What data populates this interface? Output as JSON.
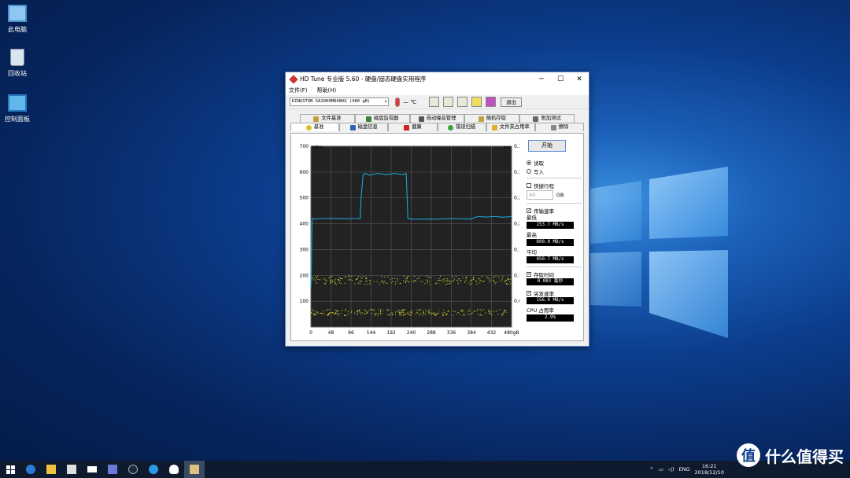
{
  "desktop": {
    "icons": [
      {
        "label": "此电脑",
        "icon": "computer-icon"
      },
      {
        "label": "回收站",
        "icon": "recycle-bin-icon"
      },
      {
        "label": "控制面板",
        "icon": "control-panel-icon"
      }
    ]
  },
  "window": {
    "title": "HD Tune 专业版 5.60 - 硬盘/固态硬盘实用程序",
    "menu": [
      "文件(F)",
      "帮助(H)"
    ],
    "drive": "KINGSTON SA1000M8480G (480 gB)",
    "temperature": "— ℃",
    "exit_label": "退出",
    "tabs_top": [
      "文件基准",
      "磁盘监视器",
      "自动噪音管理",
      "随机存取",
      "附加测试"
    ],
    "tabs_bottom": [
      "基准",
      "磁盘信息",
      "健康",
      "错误扫描",
      "文件夹占用率",
      "擦除"
    ],
    "active_tab": "基准"
  },
  "side": {
    "start_label": "开始",
    "read_label": "读取",
    "write_label": "写入",
    "quick_label": "快捷行程",
    "quick_value": "40",
    "quick_unit": "GB",
    "transfer_label": "传输速率",
    "min_label": "最低",
    "min_value": "153.7 MB/s",
    "max_label": "最高",
    "max_value": "600.0 MB/s",
    "avg_label": "平均",
    "avg_value": "450.7 MB/s",
    "access_label": "存取时间",
    "access_value": "0.083 毫秒",
    "burst_label": "突发速率",
    "burst_value": "156.9 MB/s",
    "cpu_label": "CPU 占用率",
    "cpu_value": "2.9%"
  },
  "chart_data": {
    "type": "line",
    "y_unit_left": "MB/s",
    "y_unit_right": "ms",
    "ylim": [
      0,
      700
    ],
    "ylim_right": [
      0,
      0.35
    ],
    "x_ticks": [
      "0",
      "48",
      "96",
      "144",
      "192",
      "240",
      "288",
      "336",
      "384",
      "432",
      "480gB"
    ],
    "y_ticks_left": [
      "100",
      "200",
      "300",
      "400",
      "500",
      "600",
      "700"
    ],
    "y_ticks_right": [
      "0.05",
      "0.10",
      "0.15",
      "0.20",
      "0.25",
      "0.30",
      "0.35"
    ],
    "series": [
      {
        "values_x": [
          0,
          1,
          2,
          3,
          5,
          10,
          20,
          40,
          60,
          80,
          100,
          110,
          118,
          120,
          125,
          130,
          140,
          160,
          180,
          200,
          220,
          228,
          232,
          240,
          260,
          300,
          340,
          380,
          400,
          420,
          440,
          460,
          480
        ],
        "values_y": [
          153,
          200,
          330,
          420,
          420,
          418,
          420,
          420,
          421,
          419,
          420,
          420,
          420,
          500,
          590,
          595,
          588,
          595,
          590,
          595,
          590,
          595,
          420,
          418,
          418,
          418,
          420,
          418,
          428,
          426,
          428,
          425,
          428
        ]
      }
    ],
    "access_clusters_ms": [
      0.029,
      0.089,
      0.094
    ],
    "grid": true,
    "colors": {
      "line": "#1aa3d9",
      "dots": "#e0e030",
      "bg": "#222222"
    }
  },
  "taskbar": {
    "lang": "ENG",
    "time": "16:21",
    "date": "2018/12/10"
  },
  "watermark": {
    "badge": "值",
    "text": "什么值得买"
  }
}
